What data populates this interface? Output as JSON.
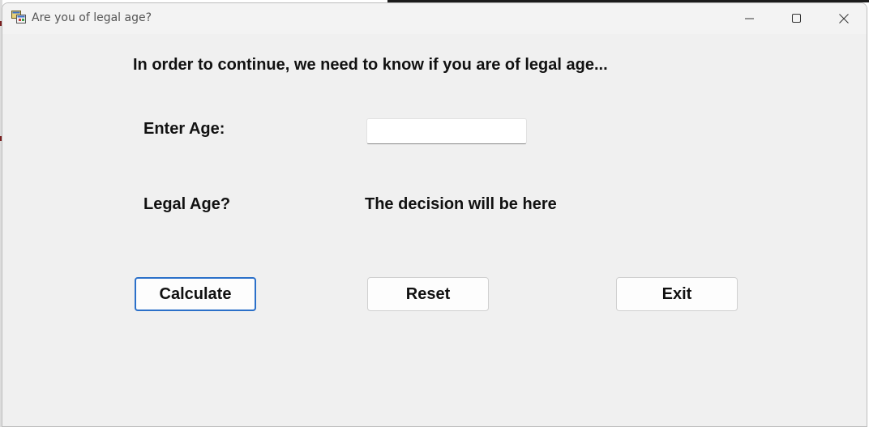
{
  "window": {
    "title": "Are you of legal age?",
    "icon": "windows-form-icon",
    "controls": [
      "minimize-icon",
      "maximize-icon",
      "close-icon"
    ]
  },
  "form": {
    "heading": "In order to continue, we need to know if you are of legal age...",
    "age_label": "Enter Age:",
    "age_value": "",
    "legal_label": "Legal Age?",
    "decision_text": "The decision will be here"
  },
  "buttons": {
    "calculate": "Calculate",
    "reset": "Reset",
    "exit": "Exit"
  },
  "colors": {
    "form_background": "#f0f0f0",
    "default_button_border": "#2b70c9"
  }
}
